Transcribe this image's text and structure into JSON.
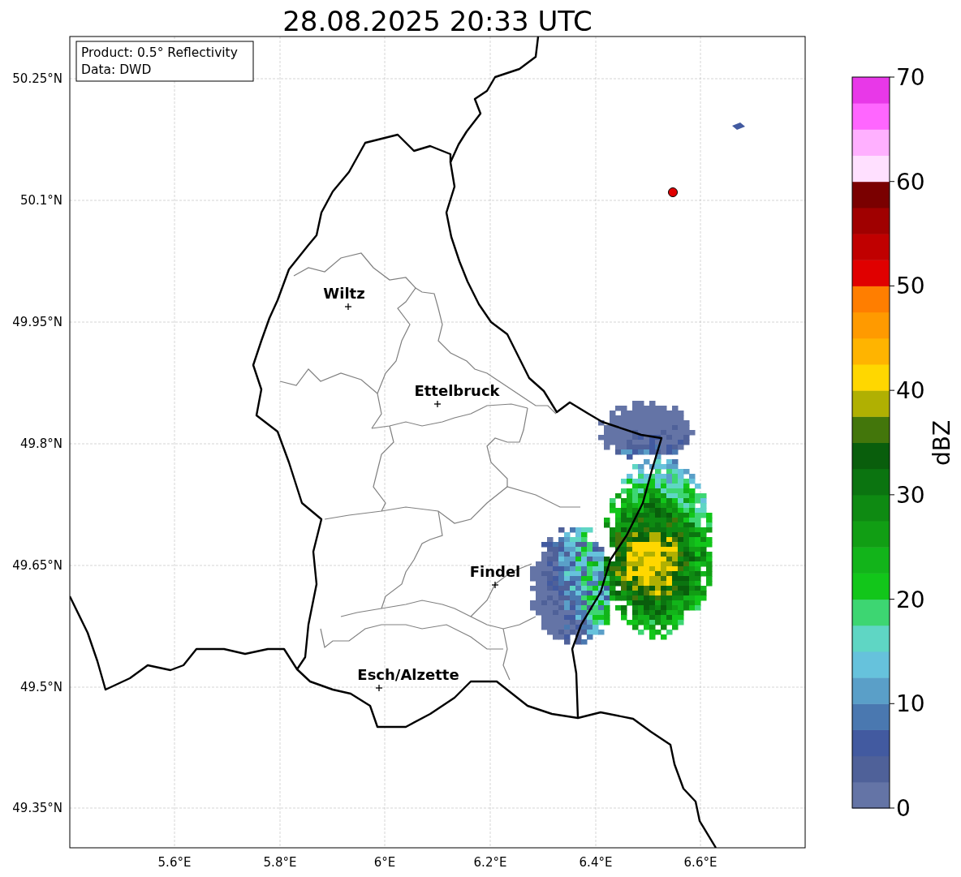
{
  "title": "28.08.2025 20:33 UTC",
  "info_box": [
    "Product: 0.5° Reflectivity",
    "Data: DWD"
  ],
  "lat_ticks": [
    "50.25°N",
    "50.1°N",
    "49.95°N",
    "49.8°N",
    "49.65°N",
    "49.5°N",
    "49.35°N"
  ],
  "lon_ticks": [
    "5.6°E",
    "5.8°E",
    "6°E",
    "6.2°E",
    "6.4°E",
    "6.6°E"
  ],
  "places": [
    {
      "name": "Wiltz"
    },
    {
      "name": "Ettelbruck"
    },
    {
      "name": "Findel"
    },
    {
      "name": "Esch/Alzette"
    }
  ],
  "colorbar": {
    "label": "dBZ",
    "ticks": [
      "70",
      "60",
      "50",
      "40",
      "30",
      "20",
      "10",
      "0"
    ],
    "bands": [
      {
        "color": "#6474a6"
      },
      {
        "color": "#4f6199"
      },
      {
        "color": "#425aa0"
      },
      {
        "color": "#4a78b0"
      },
      {
        "color": "#5a9fc8"
      },
      {
        "color": "#66c2dc"
      },
      {
        "color": "#5fd6c4"
      },
      {
        "color": "#3dd672"
      },
      {
        "color": "#12c61a"
      },
      {
        "color": "#12b41a"
      },
      {
        "color": "#119e14"
      },
      {
        "color": "#0e8a12"
      },
      {
        "color": "#0b7410"
      },
      {
        "color": "#095e0c"
      },
      {
        "color": "#43760b"
      },
      {
        "color": "#b0b002"
      },
      {
        "color": "#ffd700"
      },
      {
        "color": "#ffb400"
      },
      {
        "color": "#ff9a00"
      },
      {
        "color": "#ff7e00"
      },
      {
        "color": "#e00000"
      },
      {
        "color": "#c00000"
      },
      {
        "color": "#a00000"
      },
      {
        "color": "#7a0000"
      },
      {
        "color": "#ffe0ff"
      },
      {
        "color": "#ffb0ff"
      },
      {
        "color": "#ff66ff"
      },
      {
        "color": "#e838e8"
      }
    ]
  }
}
